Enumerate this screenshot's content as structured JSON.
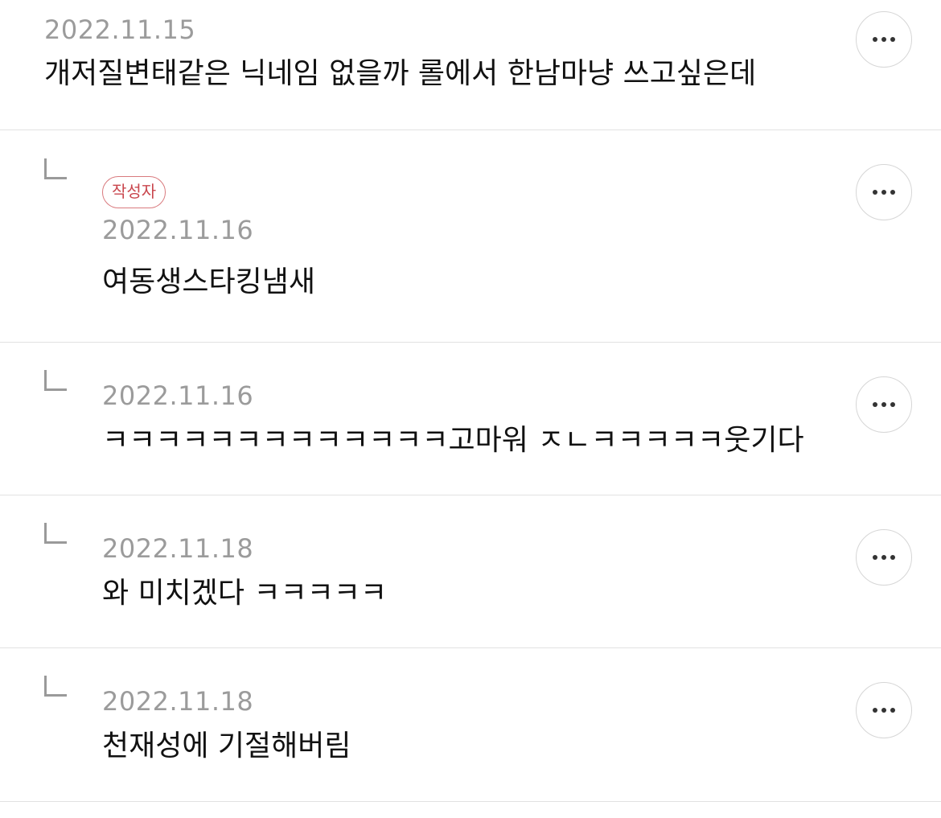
{
  "comments": [
    {
      "date": "2022.11.15",
      "text": "개저질변태같은 닉네임 없을까 롤에서 한남마냥 쓰고싶은데",
      "is_reply": false,
      "author_badge": null,
      "more_icon": "more-horizontal-icon"
    },
    {
      "date": "2022.11.16",
      "text": "여동생스타킹냄새",
      "is_reply": true,
      "author_badge": "작성자",
      "more_icon": "more-horizontal-icon"
    },
    {
      "date": "2022.11.16",
      "text": "ㅋㅋㅋㅋㅋㅋㅋㅋㅋㅋㅋㅋㅋ고마워 ㅈㄴㅋㅋㅋㅋㅋ웃기다",
      "is_reply": true,
      "author_badge": null,
      "more_icon": "more-horizontal-icon"
    },
    {
      "date": "2022.11.18",
      "text": "와 미치겠다 ㅋㅋㅋㅋㅋ",
      "is_reply": true,
      "author_badge": null,
      "more_icon": "more-horizontal-icon"
    },
    {
      "date": "2022.11.18",
      "text": "천재성에 기절해버림",
      "is_reply": true,
      "author_badge": null,
      "more_icon": "more-horizontal-icon"
    }
  ],
  "colors": {
    "badge": "#c9464d",
    "date": "#9b9b9b",
    "divider": "#e2e2e2"
  }
}
